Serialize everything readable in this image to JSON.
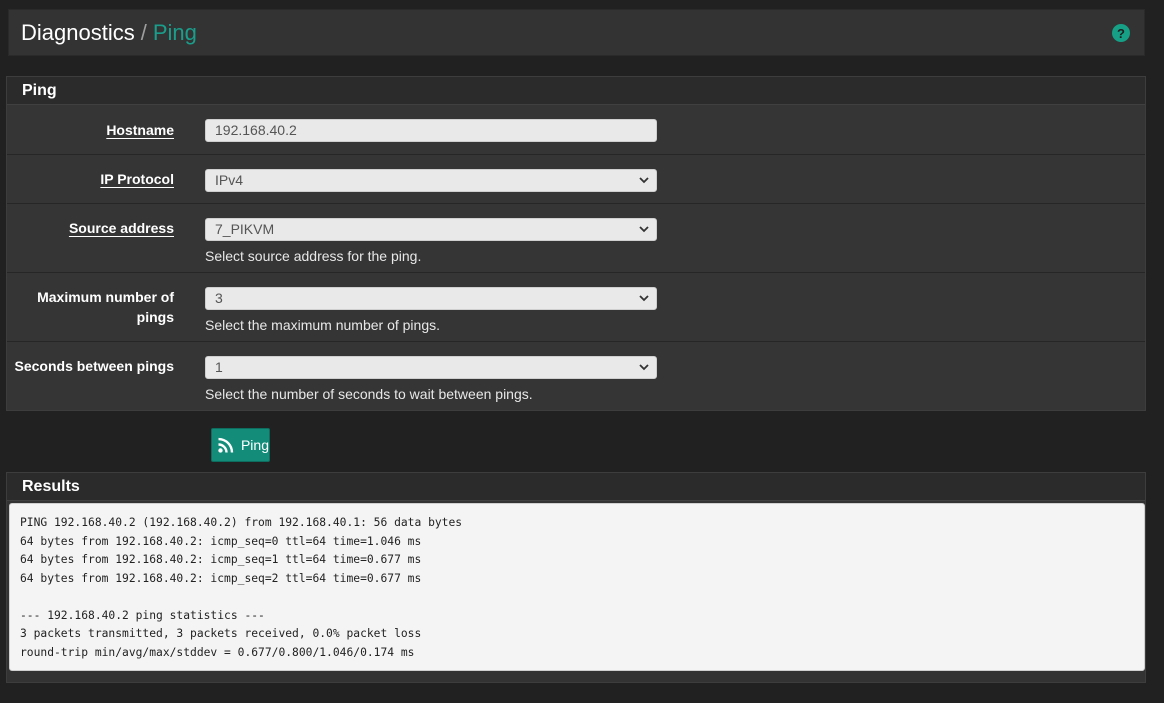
{
  "breadcrumb": {
    "section": "Diagnostics",
    "separator": "/",
    "current": "Ping"
  },
  "help_icon": {
    "glyph": "?"
  },
  "ping_panel": {
    "title": "Ping",
    "rows": {
      "hostname": {
        "label": "Hostname",
        "value": "192.168.40.2"
      },
      "ip_protocol": {
        "label": "IP Protocol",
        "value": "IPv4"
      },
      "source_address": {
        "label": "Source address",
        "value": "7_PIKVM",
        "help": "Select source address for the ping."
      },
      "max_pings": {
        "label_line1": "Maximum number of",
        "label_line2": "pings",
        "value": "3",
        "help": "Select the maximum number of pings."
      },
      "seconds_between": {
        "label": "Seconds between pings",
        "value": "1",
        "help": "Select the number of seconds to wait between pings."
      }
    }
  },
  "ping_button": {
    "label": "Ping",
    "icon": "rss-icon"
  },
  "results_panel": {
    "title": "Results",
    "output": "PING 192.168.40.2 (192.168.40.2) from 192.168.40.1: 56 data bytes\n64 bytes from 192.168.40.2: icmp_seq=0 ttl=64 time=1.046 ms\n64 bytes from 192.168.40.2: icmp_seq=1 ttl=64 time=0.677 ms\n64 bytes from 192.168.40.2: icmp_seq=2 ttl=64 time=0.677 ms\n\n--- 192.168.40.2 ping statistics ---\n3 packets transmitted, 3 packets received, 0.0% packet loss\nround-trip min/avg/max/stddev = 0.677/0.800/1.046/0.174 ms"
  },
  "colors": {
    "accent": "#1a9e8c",
    "button": "#138d7a",
    "panel": "#333333",
    "background": "#212121"
  }
}
